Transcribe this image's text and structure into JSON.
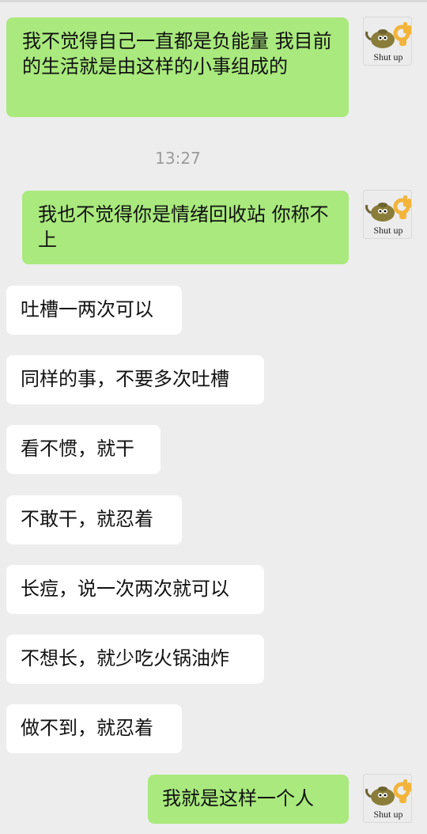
{
  "chat": {
    "timestamp": "13:27",
    "avatar_caption": "Shut up",
    "messages": [
      {
        "side": "out",
        "text": "我不觉得自己一直都是负能量 我目前的生活就是由这样的小事组成的"
      },
      {
        "side": "out",
        "text": "我也不觉得你是情绪回收站 你称不上"
      },
      {
        "side": "in",
        "text": "吐槽一两次可以"
      },
      {
        "side": "in",
        "text": "同样的事，不要多次吐槽"
      },
      {
        "side": "in",
        "text": "看不惯，就干"
      },
      {
        "side": "in",
        "text": "不敢干，就忍着"
      },
      {
        "side": "in",
        "text": "长痘，说一次两次就可以"
      },
      {
        "side": "in",
        "text": "不想长，就少吃火锅油炸"
      },
      {
        "side": "in",
        "text": "做不到，就忍着"
      },
      {
        "side": "out",
        "text": "我就是这样一个人"
      }
    ]
  }
}
